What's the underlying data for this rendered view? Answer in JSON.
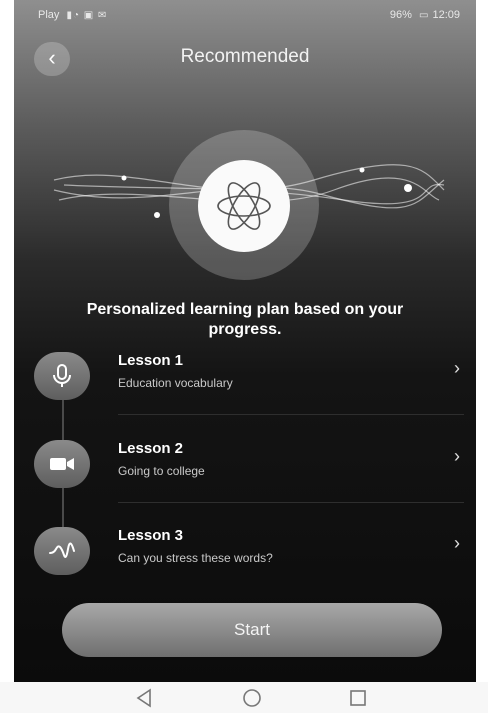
{
  "status_bar": {
    "carrier": "Play",
    "battery": "96%",
    "time": "12:09"
  },
  "header": {
    "back_icon": "chevron-left-icon",
    "title": "Recommended"
  },
  "hero": {
    "icon": "atom-icon"
  },
  "tagline": "Personalized learning plan based on your progress.",
  "lessons": [
    {
      "title": "Lesson 1",
      "subtitle": "Education vocabulary",
      "icon": "microphone-icon"
    },
    {
      "title": "Lesson 2",
      "subtitle": "Going to college",
      "icon": "video-camera-icon"
    },
    {
      "title": "Lesson 3",
      "subtitle": "Can you stress these words?",
      "icon": "waveform-icon"
    }
  ],
  "start_label": "Start",
  "system_nav": [
    "back-triangle-icon",
    "home-circle-icon",
    "recents-square-icon"
  ],
  "colors": {
    "accent_button": "#8c8c8c",
    "background_dark": "#0b0b0b"
  }
}
